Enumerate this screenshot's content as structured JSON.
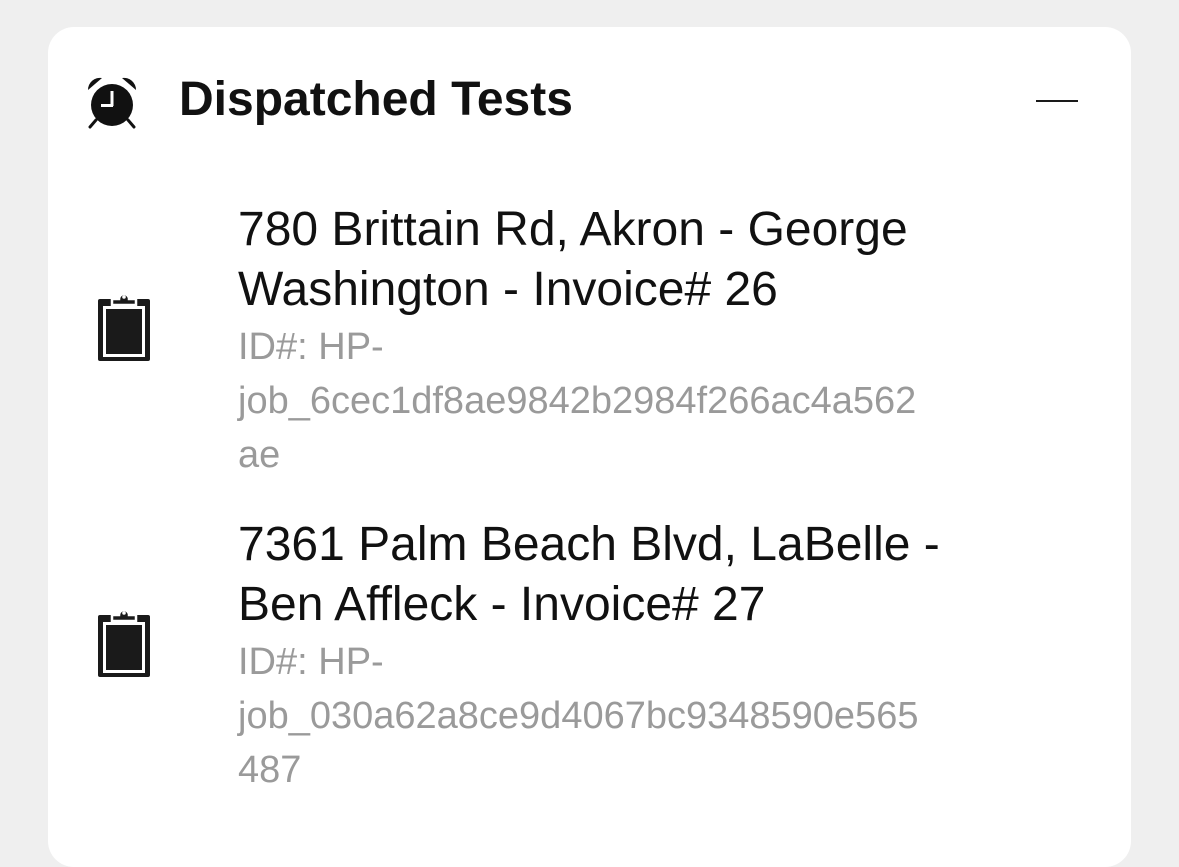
{
  "header": {
    "title": "Dispatched Tests",
    "icon": "alarm-clock-icon",
    "collapse_icon": "minus-icon"
  },
  "items": [
    {
      "title_line1": "780 Brittain Rd, Akron - George",
      "title_line2": "Washington - Invoice# 26",
      "id_line1": "ID#: HP-",
      "id_line2": "job_6cec1df8ae9842b2984f266ac4a562",
      "id_line3": "ae",
      "icon": "clipboard-icon"
    },
    {
      "title_line1": "7361 Palm Beach Blvd, LaBelle -",
      "title_line2": "Ben Affleck - Invoice# 27",
      "id_line1": "ID#: HP-",
      "id_line2": "job_030a62a8ce9d4067bc9348590e565",
      "id_line3": "487",
      "icon": "clipboard-icon"
    }
  ],
  "colors": {
    "background": "#efefef",
    "card": "#ffffff",
    "text": "#111111",
    "subtext": "#9a9a9a"
  }
}
